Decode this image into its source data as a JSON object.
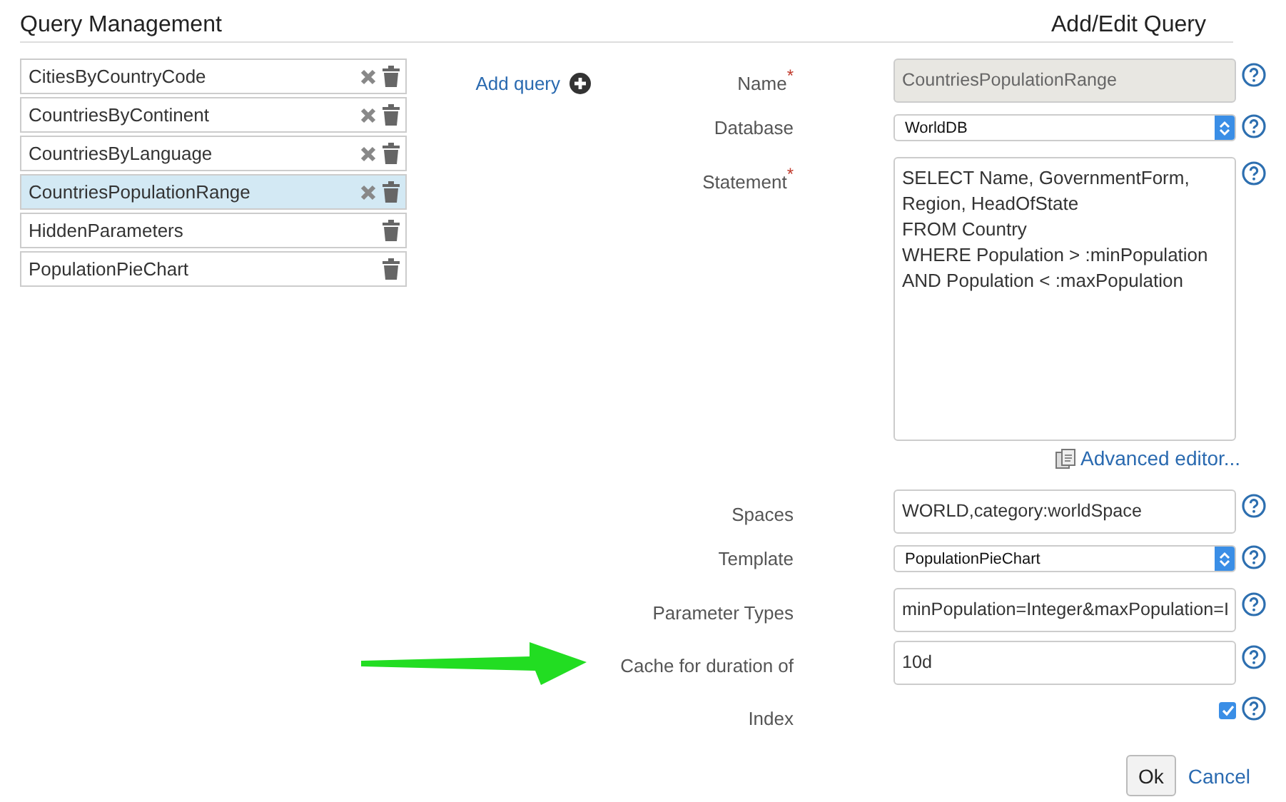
{
  "query_management": {
    "title": "Query Management",
    "add_query": "Add query",
    "queries": [
      {
        "name": "CitiesByCountryCode",
        "selected": false,
        "clearable": true
      },
      {
        "name": "CountriesByContinent",
        "selected": false,
        "clearable": true
      },
      {
        "name": "CountriesByLanguage",
        "selected": false,
        "clearable": true
      },
      {
        "name": "CountriesPopulationRange",
        "selected": true,
        "clearable": true
      },
      {
        "name": "HiddenParameters",
        "selected": false,
        "clearable": false
      },
      {
        "name": "PopulationPieChart",
        "selected": false,
        "clearable": false
      }
    ]
  },
  "form": {
    "title": "Add/Edit Query",
    "fields": [
      {
        "kind": "text",
        "label": "Name",
        "required_mark": "*",
        "disabled": true,
        "value": "CountriesPopulationRange"
      },
      {
        "kind": "select",
        "label": "Database",
        "disabled": false,
        "value": "WorldDB"
      },
      {
        "kind": "textarea",
        "label": "Statement",
        "required_mark": "*",
        "disabled": false,
        "value": "SELECT Name, GovernmentForm,\nRegion, HeadOfState\nFROM Country\nWHERE Population > :minPopulation\nAND Population < :maxPopulation"
      },
      {
        "kind": "link",
        "text": "Advanced editor..."
      },
      {
        "kind": "text",
        "label": "Spaces",
        "disabled": false,
        "value": "WORLD,category:worldSpace"
      },
      {
        "kind": "select",
        "label": "Template",
        "disabled": false,
        "value": "PopulationPieChart"
      },
      {
        "kind": "text",
        "label": "Parameter Types",
        "disabled": false,
        "value": "minPopulation=Integer&maxPopulation=I"
      },
      {
        "kind": "text",
        "label": "Cache for duration of",
        "disabled": false,
        "value": "10d"
      },
      {
        "kind": "checkbox",
        "label": "Index",
        "disabled": false,
        "checked": true
      }
    ],
    "ok": "Ok",
    "cancel": "Cancel"
  }
}
